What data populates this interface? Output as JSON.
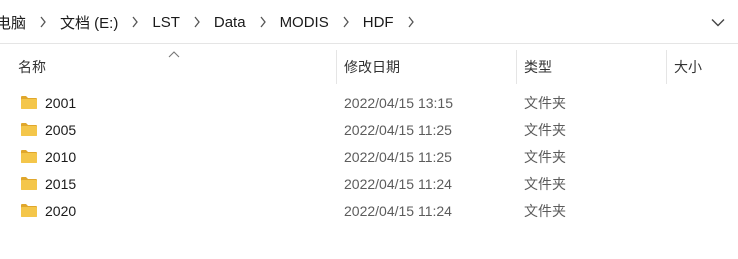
{
  "breadcrumb": {
    "items": [
      {
        "label": "电脑"
      },
      {
        "label": "文档 (E:)"
      },
      {
        "label": "LST"
      },
      {
        "label": "Data"
      },
      {
        "label": "MODIS"
      },
      {
        "label": "HDF"
      }
    ]
  },
  "columns": {
    "name": "名称",
    "modified": "修改日期",
    "type": "类型",
    "size": "大小"
  },
  "files": [
    {
      "name": "2001",
      "modified": "2022/04/15 13:15",
      "type": "文件夹",
      "icon": "folder-icon"
    },
    {
      "name": "2005",
      "modified": "2022/04/15 11:25",
      "type": "文件夹",
      "icon": "folder-icon"
    },
    {
      "name": "2010",
      "modified": "2022/04/15 11:25",
      "type": "文件夹",
      "icon": "folder-icon"
    },
    {
      "name": "2015",
      "modified": "2022/04/15 11:24",
      "type": "文件夹",
      "icon": "folder-icon"
    },
    {
      "name": "2020",
      "modified": "2022/04/15 11:24",
      "type": "文件夹",
      "icon": "folder-icon"
    }
  ],
  "colors": {
    "folder": "#f4c64a",
    "folder_tab": "#e0a72c",
    "divider": "#e5e5e5"
  }
}
